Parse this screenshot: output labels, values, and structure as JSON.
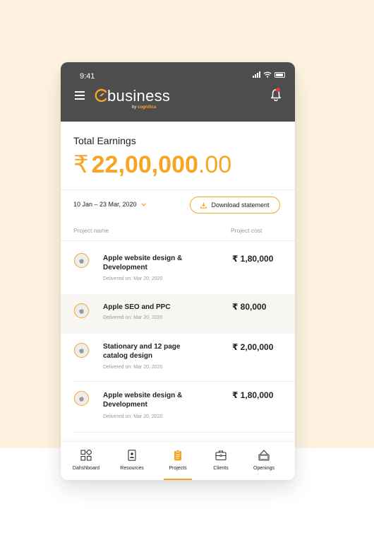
{
  "status_bar": {
    "time": "9:41"
  },
  "header": {
    "brand": "business",
    "brand_sub_prefix": "by",
    "brand_sub": "cognitica",
    "accent_color": "#f5a623",
    "bar_color": "#4d4d4d"
  },
  "earnings": {
    "label": "Total Earnings",
    "currency": "₹",
    "amount_main": "22,00,000",
    "amount_decimal": ".00"
  },
  "filters": {
    "date_range": "10 Jan – 23 Mar, 2020",
    "download_label": "Download statement"
  },
  "table": {
    "col_name": "Project name",
    "col_cost": "Project cost",
    "rows": [
      {
        "title": "Apple website design & Development",
        "delivered": "Delivered on: Mar 20, 2020",
        "cost": "₹ 1,80,000",
        "icon": "apple-icon"
      },
      {
        "title": "Apple SEO and PPC",
        "delivered": "Delivered on: Mar 20, 2020",
        "cost": "₹ 80,000",
        "icon": "apple-icon"
      },
      {
        "title": "Stationary and 12 page catalog design",
        "delivered": "Delivered on: Mar 20, 2020",
        "cost": "₹ 2,00,000",
        "icon": "apple-icon"
      },
      {
        "title": "Apple website design & Development",
        "delivered": "Delivered on: Mar 20, 2020",
        "cost": "₹ 1,80,000",
        "icon": "apple-icon"
      }
    ]
  },
  "nav": {
    "items": [
      {
        "label": "Dahshboard",
        "icon": "dashboard-icon"
      },
      {
        "label": "Resources",
        "icon": "resources-icon"
      },
      {
        "label": "Projects",
        "icon": "projects-icon",
        "active": true
      },
      {
        "label": "Clients",
        "icon": "briefcase-icon"
      },
      {
        "label": "Openings",
        "icon": "open-sign-icon"
      }
    ]
  }
}
